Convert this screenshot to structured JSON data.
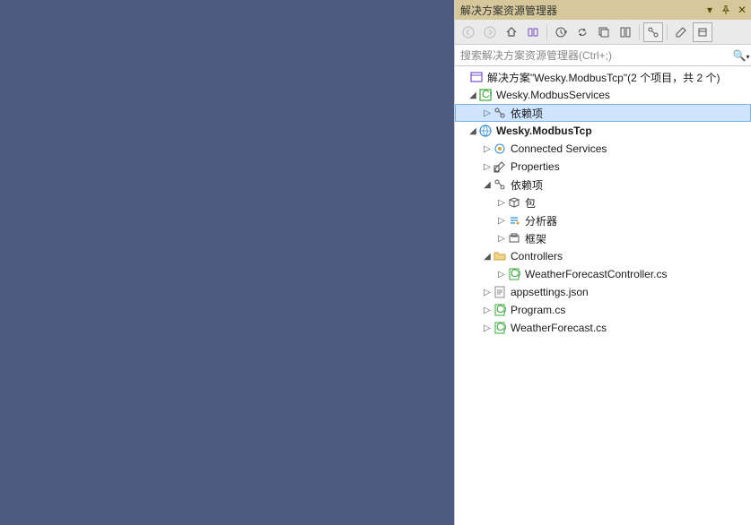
{
  "panel": {
    "title": "解决方案资源管理器",
    "searchPlaceholder": "搜索解决方案资源管理器(Ctrl+;)"
  },
  "tree": {
    "solution": "解决方案\"Wesky.ModbusTcp\"(2 个项目，共 2 个)",
    "proj1": "Wesky.ModbusServices",
    "proj1_deps": "依赖项",
    "proj2": "Wesky.ModbusTcp",
    "connectedServices": "Connected Services",
    "properties": "Properties",
    "proj2_deps": "依赖项",
    "packages": "包",
    "analyzers": "分析器",
    "frameworks": "框架",
    "controllers": "Controllers",
    "controllerFile": "WeatherForecastController.cs",
    "appsettings": "appsettings.json",
    "program": "Program.cs",
    "weatherForecast": "WeatherForecast.cs"
  }
}
